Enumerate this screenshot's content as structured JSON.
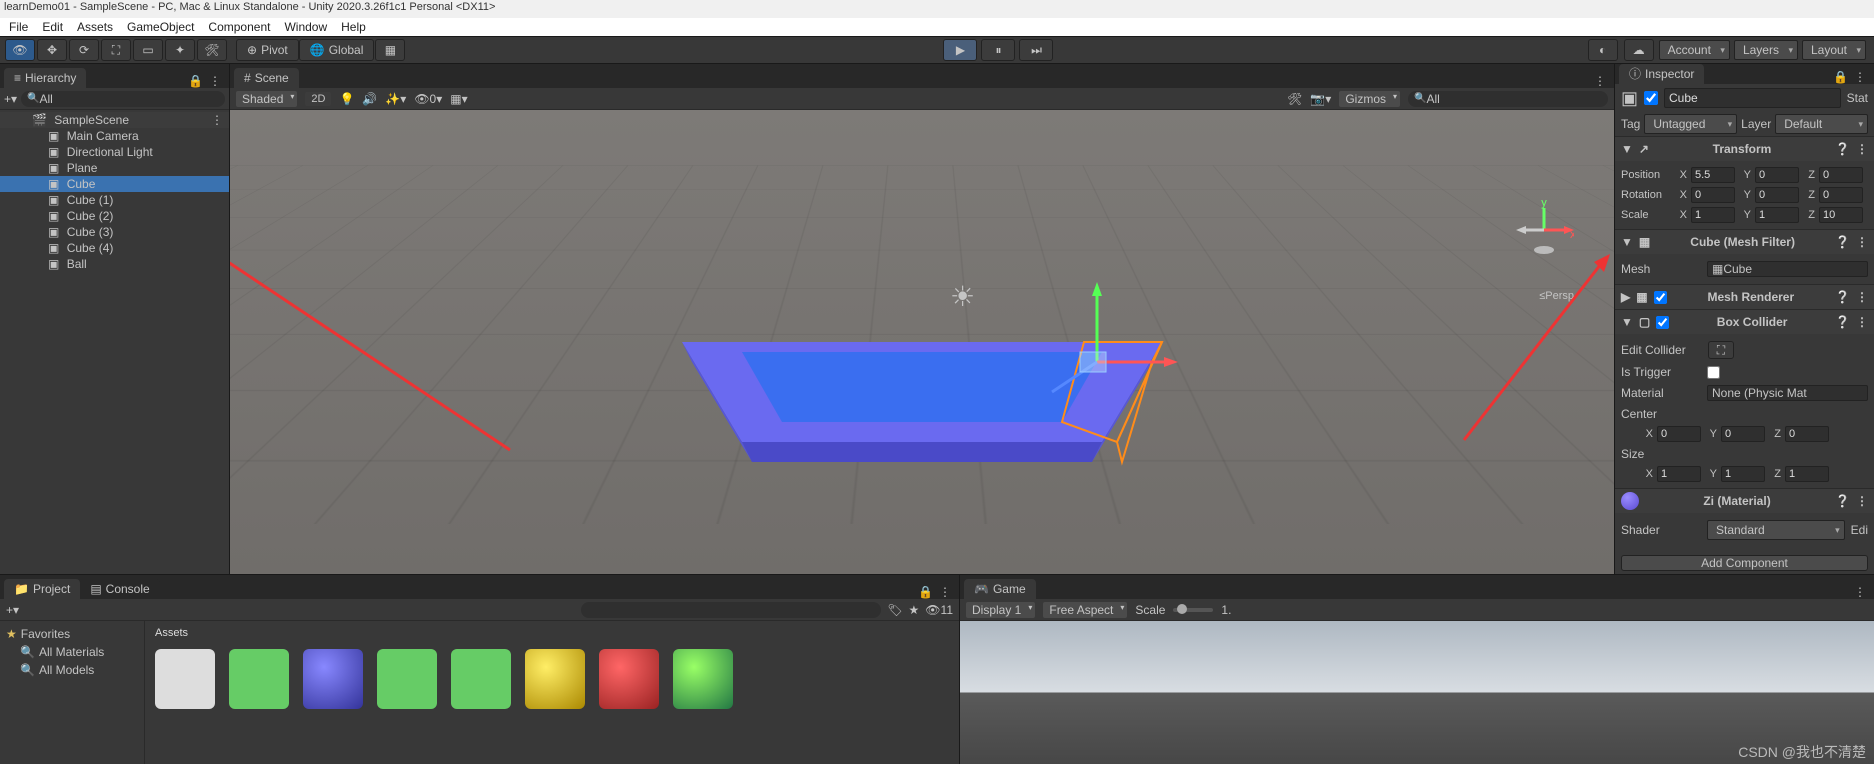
{
  "title": "learnDemo01 - SampleScene - PC, Mac & Linux Standalone - Unity 2020.3.26f1c1 Personal <DX11>",
  "menu": [
    "File",
    "Edit",
    "Assets",
    "GameObject",
    "Component",
    "Window",
    "Help"
  ],
  "toolbar": {
    "pivot": "Pivot",
    "global": "Global",
    "account": "Account",
    "layers": "Layers",
    "layout": "Layout"
  },
  "hierarchy": {
    "tab": "Hierarchy",
    "search_placeholder": "All",
    "scene": "SampleScene",
    "items": [
      "Main Camera",
      "Directional Light",
      "Plane",
      "Cube",
      "Cube (1)",
      "Cube (2)",
      "Cube (3)",
      "Cube (4)",
      "Ball"
    ],
    "selected_index": 3
  },
  "scene": {
    "tab": "Scene",
    "shading": "Shaded",
    "mode2d": "2D",
    "gizmos": "Gizmos",
    "search_placeholder": "All",
    "persp": "≤Persp",
    "light_count": "0"
  },
  "inspector": {
    "tab": "Inspector",
    "name": "Cube",
    "static": "Stat",
    "tag_label": "Tag",
    "tag": "Untagged",
    "layer_label": "Layer",
    "layer": "Default",
    "transform": {
      "title": "Transform",
      "position": {
        "label": "Position",
        "x": "5.5",
        "y": "0",
        "z": "0"
      },
      "rotation": {
        "label": "Rotation",
        "x": "0",
        "y": "0",
        "z": "0"
      },
      "scale": {
        "label": "Scale",
        "x": "1",
        "y": "1",
        "z": "10"
      }
    },
    "mesh_filter": {
      "title": "Cube (Mesh Filter)",
      "mesh_label": "Mesh",
      "mesh_value": "Cube"
    },
    "mesh_renderer": {
      "title": "Mesh Renderer"
    },
    "box_collider": {
      "title": "Box Collider",
      "edit": "Edit Collider",
      "is_trigger": "Is Trigger",
      "material_label": "Material",
      "material_value": "None (Physic Mat",
      "center_label": "Center",
      "center": {
        "x": "0",
        "y": "0",
        "z": "0"
      },
      "size_label": "Size",
      "size": {
        "x": "1",
        "y": "1",
        "z": "1"
      }
    },
    "material": {
      "title": "Zi (Material)",
      "shader_label": "Shader",
      "shader_value": "Standard",
      "edit": "Edi"
    },
    "add_component": "Add Component"
  },
  "project": {
    "tab_project": "Project",
    "tab_console": "Console",
    "favorites": "Favorites",
    "all_materials": "All Materials",
    "all_models": "All Models",
    "assets_label": "Assets",
    "hidden_count": "11"
  },
  "game": {
    "tab": "Game",
    "display": "Display 1",
    "aspect": "Free Aspect",
    "scale_label": "Scale",
    "scale_value": "1."
  },
  "watermark": "CSDN @我也不清楚"
}
